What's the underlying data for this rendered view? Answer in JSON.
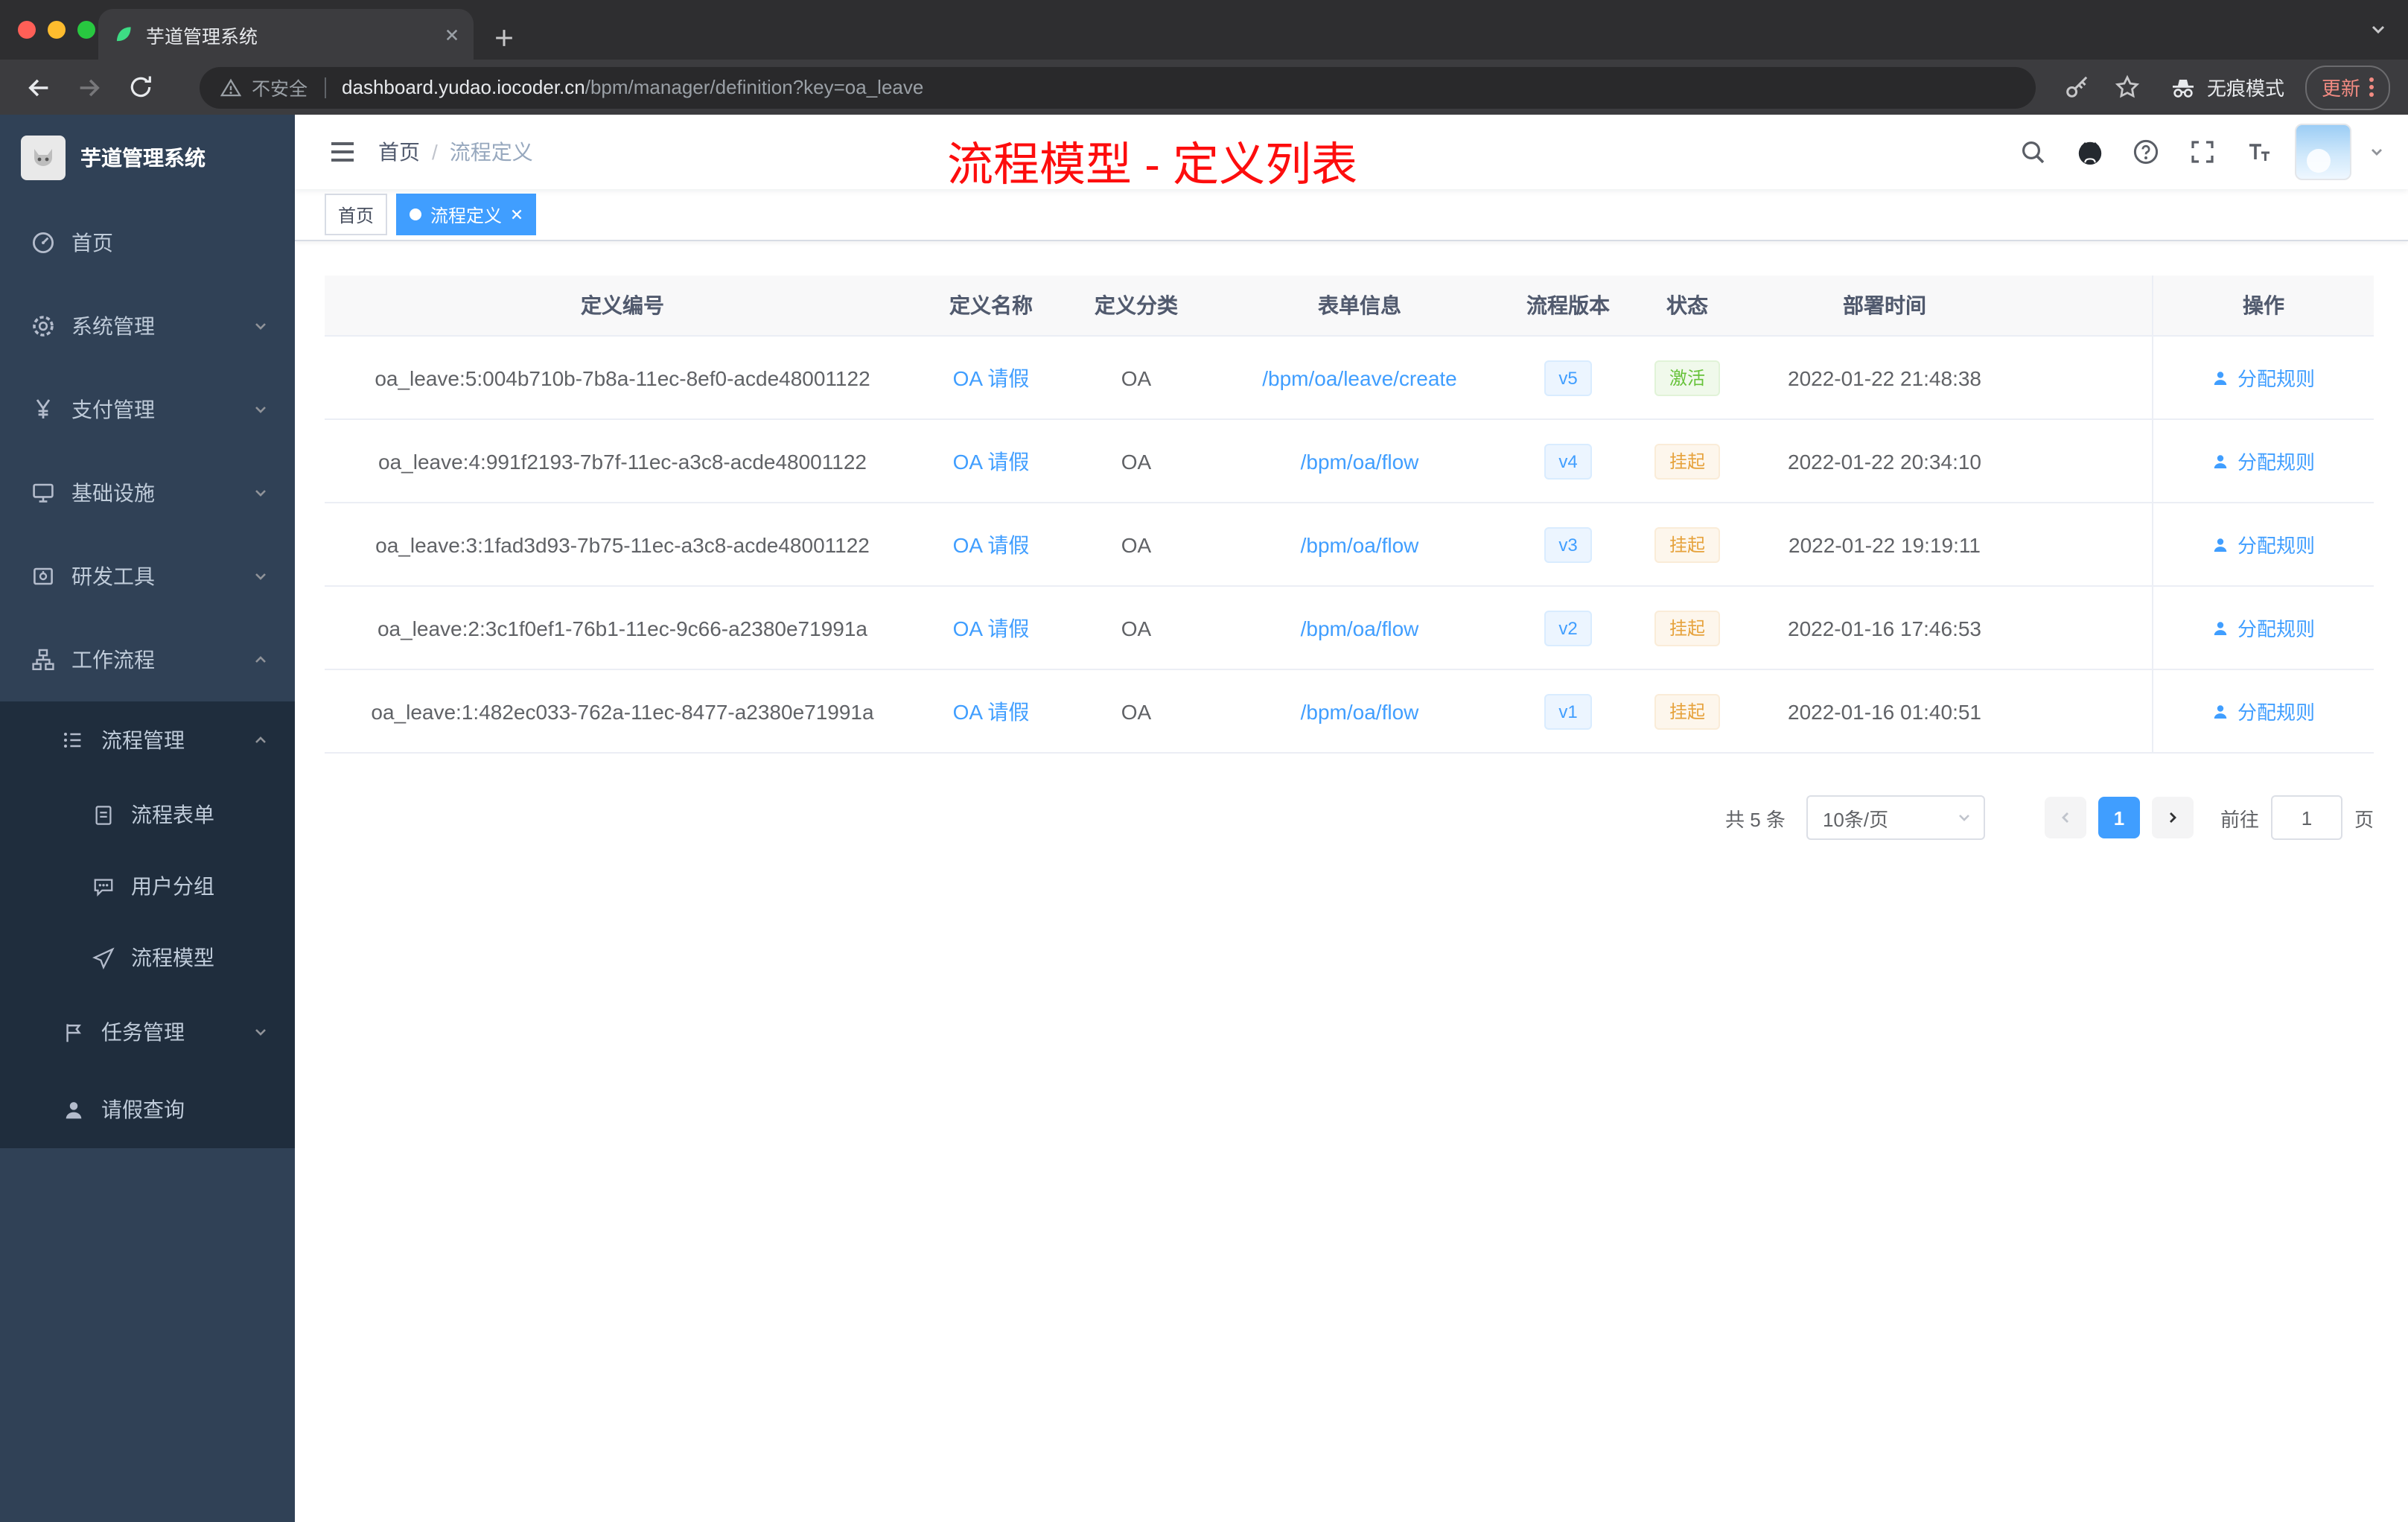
{
  "browser": {
    "tab_title": "芋道管理系统",
    "security_label": "不安全",
    "url_host": "dashboard.yudao.iocoder.cn",
    "url_path": "/bpm/manager/definition?key=oa_leave",
    "incognito_label": "无痕模式",
    "update_label": "更新"
  },
  "sidebar": {
    "app_title": "芋道管理系统",
    "items": [
      {
        "label": "首页",
        "icon": "dashboard-icon"
      },
      {
        "label": "系统管理",
        "icon": "gear-icon"
      },
      {
        "label": "支付管理",
        "icon": "yen-icon"
      },
      {
        "label": "基础设施",
        "icon": "monitor-icon"
      },
      {
        "label": "研发工具",
        "icon": "toolbox-icon"
      },
      {
        "label": "工作流程",
        "icon": "workflow-icon"
      },
      {
        "label": "流程管理",
        "icon": "list-icon"
      },
      {
        "label": "流程表单",
        "icon": "document-icon"
      },
      {
        "label": "用户分组",
        "icon": "user-group-icon"
      },
      {
        "label": "流程模型",
        "icon": "paper-plane-icon"
      },
      {
        "label": "任务管理",
        "icon": "flag-icon"
      },
      {
        "label": "请假查询",
        "icon": "person-icon"
      }
    ]
  },
  "header": {
    "breadcrumb_home": "首页",
    "breadcrumb_current": "流程定义",
    "annotation": "流程模型 - 定义列表"
  },
  "tags": {
    "home": "首页",
    "active": "流程定义"
  },
  "table": {
    "headers": [
      "定义编号",
      "定义名称",
      "定义分类",
      "表单信息",
      "流程版本",
      "状态",
      "部署时间",
      "操作"
    ],
    "action_label": "分配规则",
    "rows": [
      {
        "id": "oa_leave:5:004b710b-7b8a-11ec-8ef0-acde48001122",
        "name": "OA 请假",
        "category": "OA",
        "form": "/bpm/oa/leave/create",
        "version": "v5",
        "status": "激活",
        "status_type": "success",
        "time": "2022-01-22 21:48:38"
      },
      {
        "id": "oa_leave:4:991f2193-7b7f-11ec-a3c8-acde48001122",
        "name": "OA 请假",
        "category": "OA",
        "form": "/bpm/oa/flow",
        "version": "v4",
        "status": "挂起",
        "status_type": "warning",
        "time": "2022-01-22 20:34:10"
      },
      {
        "id": "oa_leave:3:1fad3d93-7b75-11ec-a3c8-acde48001122",
        "name": "OA 请假",
        "category": "OA",
        "form": "/bpm/oa/flow",
        "version": "v3",
        "status": "挂起",
        "status_type": "warning",
        "time": "2022-01-22 19:19:11"
      },
      {
        "id": "oa_leave:2:3c1f0ef1-76b1-11ec-9c66-a2380e71991a",
        "name": "OA 请假",
        "category": "OA",
        "form": "/bpm/oa/flow",
        "version": "v2",
        "status": "挂起",
        "status_type": "warning",
        "time": "2022-01-16 17:46:53"
      },
      {
        "id": "oa_leave:1:482ec033-762a-11ec-8477-a2380e71991a",
        "name": "OA 请假",
        "category": "OA",
        "form": "/bpm/oa/flow",
        "version": "v1",
        "status": "挂起",
        "status_type": "warning",
        "time": "2022-01-16 01:40:51"
      }
    ]
  },
  "pagination": {
    "total": "共 5 条",
    "page_size": "10条/页",
    "current_page": "1",
    "goto_label": "前往",
    "goto_value": "1",
    "goto_unit": "页"
  },
  "colors": {
    "primary": "#409eff",
    "success": "#67c23a",
    "warning": "#e6a23c",
    "annotation_red": "#fd0d0d",
    "sidebar_bg": "#304156",
    "submenu_bg": "#1f2d3d"
  }
}
